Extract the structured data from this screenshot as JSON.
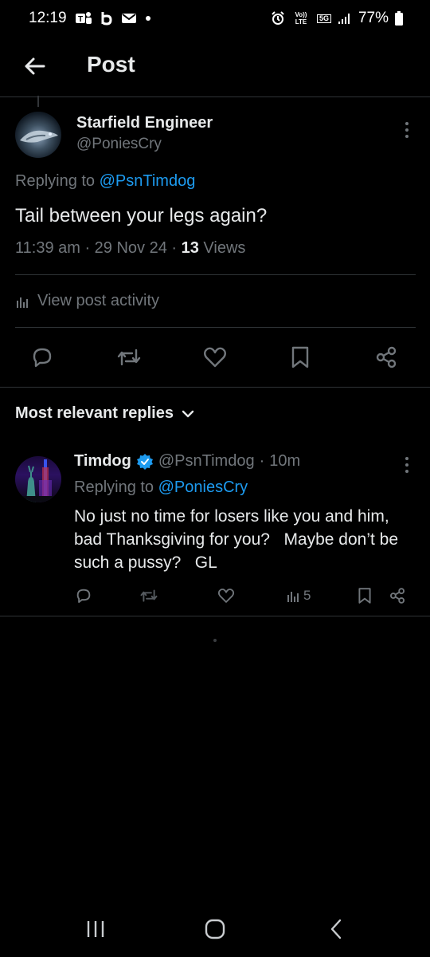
{
  "status_bar": {
    "time": "12:19",
    "battery": "77%",
    "network": "5G",
    "volte": "Vo)) LTE",
    "icons": [
      "teams-icon",
      "b-icon",
      "mail-icon",
      "dot-icon",
      "alarm-icon",
      "signal-icon",
      "battery-icon"
    ]
  },
  "header": {
    "title": "Post",
    "back_icon": "arrow-left-icon"
  },
  "post": {
    "author_name": "Starfield Engineer",
    "author_handle": "@PoniesCry",
    "replying_prefix": "Replying to ",
    "replying_handle": "@PsnTimdog",
    "text": "Tail between your legs again?",
    "time_date": "11:39 am · 29 Nov 24 · ",
    "views_count": "13",
    "views_label": " Views",
    "activity_label": "View post activity"
  },
  "actions": [
    "reply-icon",
    "repost-icon",
    "like-icon",
    "bookmark-icon",
    "share-icon"
  ],
  "replies_section": {
    "sort_label": "Most relevant replies"
  },
  "reply": {
    "author_name": "Timdog",
    "author_handle": "@PsnTimdog",
    "separator": "·",
    "time": "10m",
    "replying_prefix": "Replying to ",
    "replying_handle": "@PoniesCry",
    "text": "No just no time for losers like you and him,  bad Thanksgiving for you?   Maybe don’t be such a pussy?   GL",
    "views": "5"
  },
  "colors": {
    "background": "#000000",
    "text": "#e7e9ea",
    "muted": "#71767b",
    "accent": "#1d9bf0",
    "divider": "#2f3336"
  }
}
